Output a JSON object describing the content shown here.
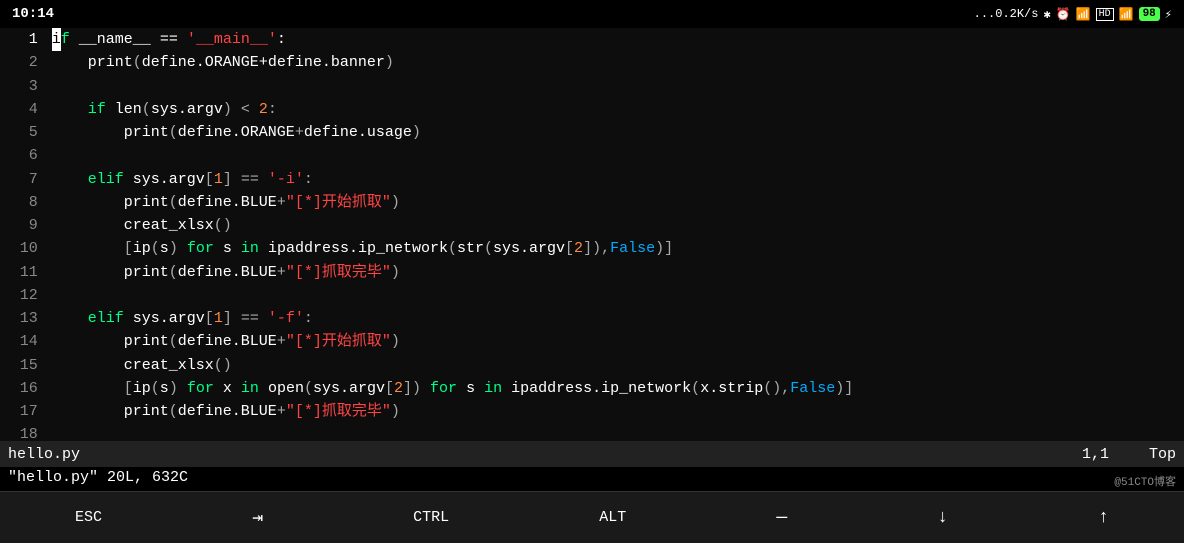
{
  "status_bar": {
    "time": "10:14",
    "network": "...0.2K/s",
    "battery": "98"
  },
  "filename": "hello.py",
  "vim_position": "1,1",
  "vim_scroll": "Top",
  "vim_message": "\"hello.py\" 20L, 632C",
  "code_lines": [
    {
      "num": 1,
      "text": "if __name__ == '__main__':"
    },
    {
      "num": 2,
      "text": "    print(define.ORANGE+define.banner)"
    },
    {
      "num": 3,
      "text": ""
    },
    {
      "num": 4,
      "text": "    if len(sys.argv) < 2:"
    },
    {
      "num": 5,
      "text": "        print(define.ORANGE+define.usage)"
    },
    {
      "num": 6,
      "text": ""
    },
    {
      "num": 7,
      "text": "    elif sys.argv[1] == '-i':"
    },
    {
      "num": 8,
      "text": "        print(define.BLUE+\"[*]开始抓取\")"
    },
    {
      "num": 9,
      "text": "        creat_xlsx()"
    },
    {
      "num": 10,
      "text": "        [ip(s) for s in ipaddress.ip_network(str(sys.argv[2]),False)]"
    },
    {
      "num": 11,
      "text": "        print(define.BLUE+\"[*]抓取完毕\")"
    },
    {
      "num": 12,
      "text": ""
    },
    {
      "num": 13,
      "text": "    elif sys.argv[1] == '-f':"
    },
    {
      "num": 14,
      "text": "        print(define.BLUE+\"[*]开始抓取\")"
    },
    {
      "num": 15,
      "text": "        creat_xlsx()"
    },
    {
      "num": 16,
      "text": "        [ip(s) for x in open(sys.argv[2]) for s in ipaddress.ip_network(x.strip(),False)]"
    },
    {
      "num": 17,
      "text": "        print(define.BLUE+\"[*]抓取完毕\")"
    },
    {
      "num": 18,
      "text": ""
    }
  ],
  "toolbar": {
    "esc": "ESC",
    "tab": "⇥",
    "ctrl": "CTRL",
    "alt": "ALT",
    "dash": "—",
    "arrow_down": "↓",
    "arrow_up": "↑"
  },
  "attribution": "@51CTO博客"
}
